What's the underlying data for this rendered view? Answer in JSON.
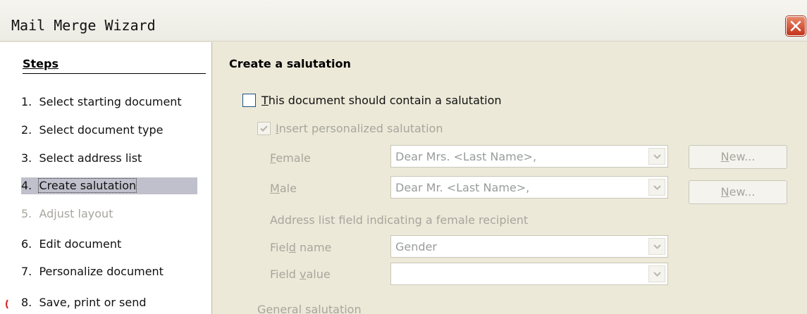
{
  "window": {
    "title": "Mail Merge Wizard"
  },
  "steps": {
    "title": "Steps",
    "items": [
      {
        "num": "1.",
        "label": "Select starting document"
      },
      {
        "num": "2.",
        "label": "Select document type"
      },
      {
        "num": "3.",
        "label": "Select address list"
      },
      {
        "num": "4.",
        "label": "Create salutation"
      },
      {
        "num": "5.",
        "label": "Adjust layout"
      },
      {
        "num": "6.",
        "label": "Edit document"
      },
      {
        "num": "7.",
        "label": "Personalize document"
      },
      {
        "num": "8.",
        "label": "Save, print or send"
      }
    ],
    "active_index": 3,
    "disabled_index": 4
  },
  "main": {
    "heading": "Create a salutation",
    "contain_salutation": {
      "key": "T",
      "rest": "his document should contain a salutation",
      "checked": false
    },
    "personalized": {
      "key": "I",
      "rest": "nsert personalized salutation",
      "checked": true
    },
    "female": {
      "key": "F",
      "rest": "emale",
      "value": "Dear Mrs. <Last Name>,",
      "new_key": "N",
      "new_rest": "ew..."
    },
    "male": {
      "key": "M",
      "rest": "ale",
      "value": "Dear Mr. <Last Name>,",
      "new_key": "N",
      "new_rest": "ew..."
    },
    "address_field_caption": "Address list field indicating a female recipient",
    "field_name": {
      "pre": "Fiel",
      "key": "d",
      "post": " name",
      "value": "Gender"
    },
    "field_value": {
      "pre": "Field ",
      "key": "v",
      "post": "alue",
      "value": ""
    },
    "general_salutation": "General salutation"
  },
  "colors": {
    "window_bg": "#ece9d8",
    "steps_bg": "#ffffff",
    "active_step_bg": "#c0c0cc",
    "disabled_text": "#a7a69d",
    "close_button": "#c4331a"
  }
}
